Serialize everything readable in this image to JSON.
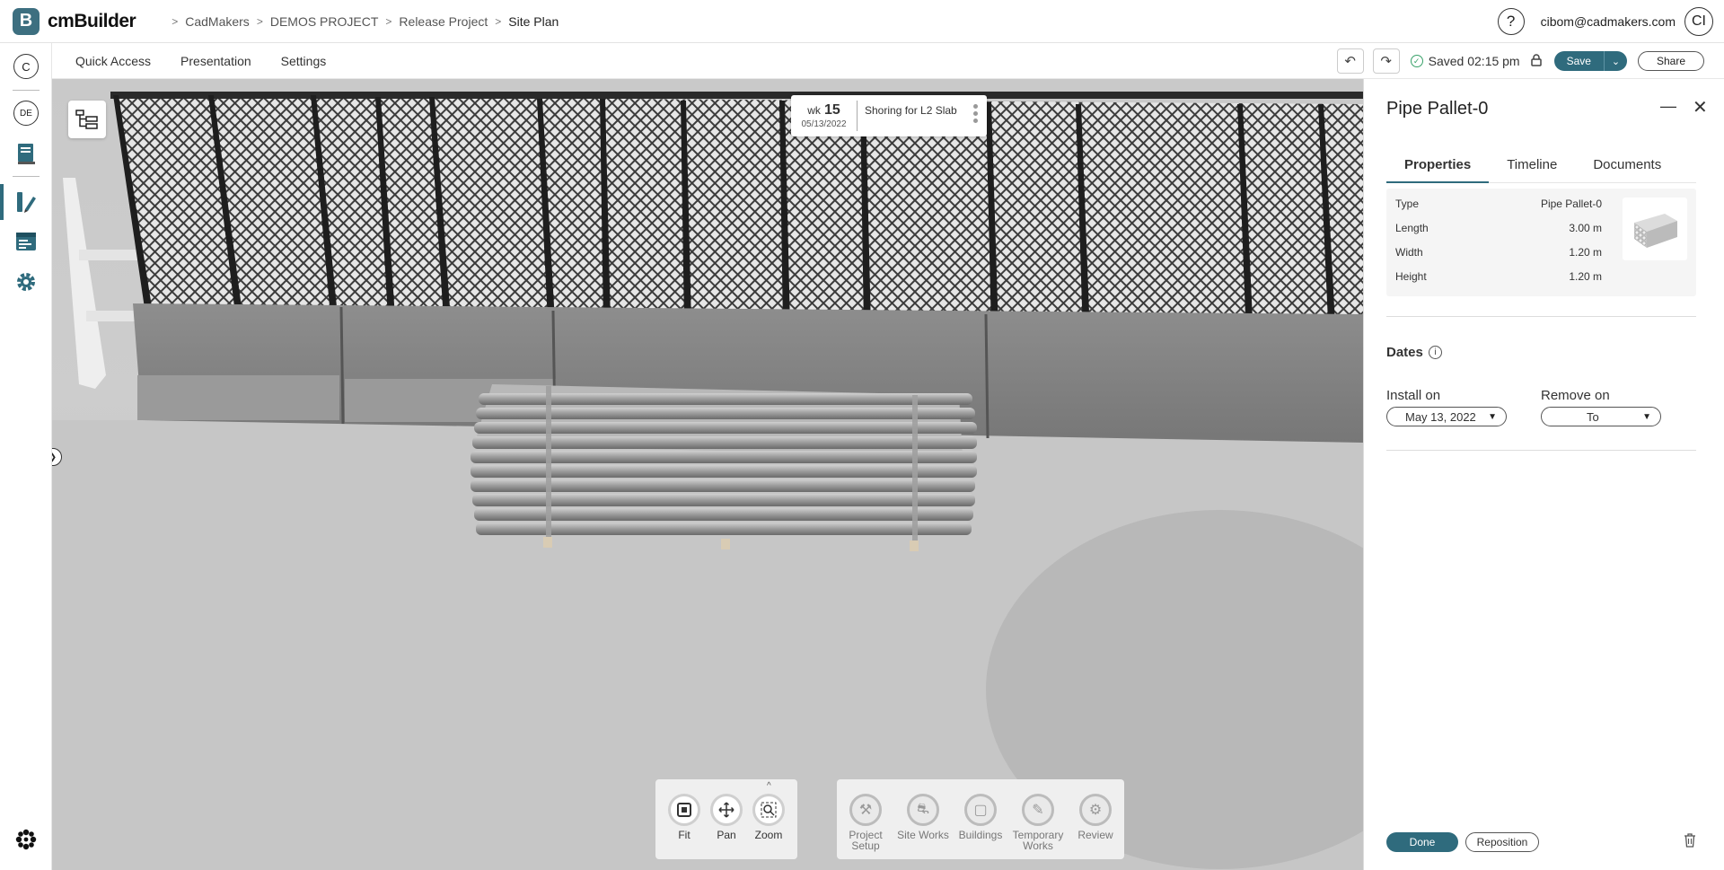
{
  "app": {
    "logo_letter": "B",
    "name": "cmBuilder"
  },
  "breadcrumb": [
    "CadMakers",
    "DEMOS PROJECT",
    "Release Project",
    "Site Plan"
  ],
  "header": {
    "help": "?",
    "user_email": "cibom@cadmakers.com",
    "avatar_initials": "CI"
  },
  "leftrail": {
    "company_badge": "C",
    "project_badge": "DE"
  },
  "toolbar": {
    "menus": [
      "Quick Access",
      "Presentation",
      "Settings"
    ],
    "saved_text": "Saved 02:15 pm",
    "save_label": "Save",
    "share_label": "Share"
  },
  "schedule_card": {
    "week_prefix": "wk",
    "week_number": "15",
    "date": "05/13/2022",
    "activity": "Shoring for L2 Slab"
  },
  "nav_tools": [
    {
      "label": "Fit",
      "icon": "fit-icon"
    },
    {
      "label": "Pan",
      "icon": "pan-icon"
    },
    {
      "label": "Zoom",
      "icon": "zoom-icon"
    }
  ],
  "work_tools": [
    {
      "label": "Project Setup",
      "icon": "project-setup-icon"
    },
    {
      "label": "Site Works",
      "icon": "site-works-icon"
    },
    {
      "label": "Buildings",
      "icon": "buildings-icon"
    },
    {
      "label": "Temporary Works",
      "icon": "temporary-works-icon"
    },
    {
      "label": "Review",
      "icon": "review-icon"
    }
  ],
  "panel": {
    "title": "Pipe Pallet-0",
    "tabs": [
      "Properties",
      "Timeline",
      "Documents"
    ],
    "properties": [
      {
        "label": "Type",
        "value": "Pipe Pallet-0"
      },
      {
        "label": "Length",
        "value": "3.00 m"
      },
      {
        "label": "Width",
        "value": "1.20 m"
      },
      {
        "label": "Height",
        "value": "1.20 m"
      }
    ],
    "dates_title": "Dates",
    "install_label": "Install on",
    "install_value": "May 13, 2022",
    "remove_label": "Remove on",
    "remove_value": "To",
    "done_label": "Done",
    "reposition_label": "Reposition"
  },
  "colors": {
    "accent": "#2f6b7d",
    "saved_ok": "#38a169"
  }
}
